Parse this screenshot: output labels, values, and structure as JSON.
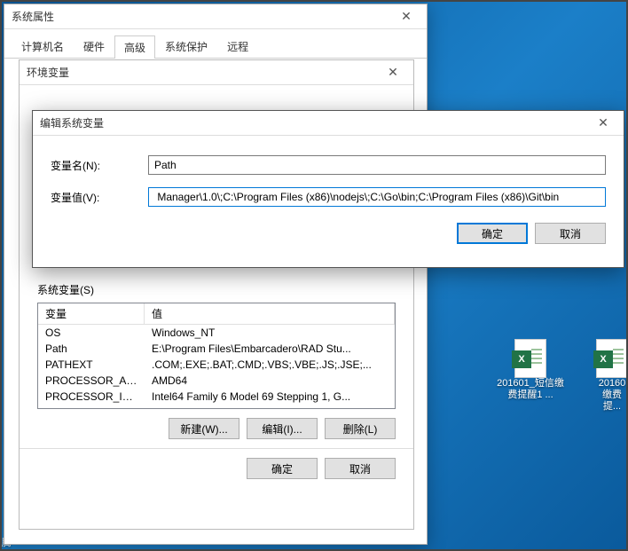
{
  "sysprops": {
    "title": "系统属性",
    "tabs": [
      "计算机名",
      "硬件",
      "高级",
      "系统保护",
      "远程"
    ],
    "active_tab_index": 2
  },
  "envdlg": {
    "title": "环境变量",
    "sys_section": "系统变量(S)",
    "columns": [
      "变量",
      "值"
    ],
    "rows": [
      {
        "name": "OS",
        "value": "Windows_NT"
      },
      {
        "name": "Path",
        "value": "E:\\Program Files\\Embarcadero\\RAD Stu..."
      },
      {
        "name": "PATHEXT",
        "value": ".COM;.EXE;.BAT;.CMD;.VBS;.VBE;.JS;.JSE;..."
      },
      {
        "name": "PROCESSOR_AR...",
        "value": "AMD64"
      },
      {
        "name": "PROCESSOR_IDE...",
        "value": "Intel64 Family 6 Model 69 Stepping 1, G..."
      }
    ],
    "buttons": {
      "new": "新建(W)...",
      "edit": "编辑(I)...",
      "delete": "删除(L)",
      "ok": "确定",
      "cancel": "取消"
    }
  },
  "editdlg": {
    "title": "编辑系统变量",
    "name_label": "变量名(N):",
    "value_label": "变量值(V):",
    "name_value": "Path",
    "value_value": " Manager\\1.0\\;C:\\Program Files (x86)\\nodejs\\;C:\\Go\\bin;C:\\Program Files (x86)\\Git\\bin",
    "ok": "确定",
    "cancel": "取消"
  },
  "desktop": {
    "icons": [
      {
        "label": "201601_短信缴费提醒1 ..."
      },
      {
        "label": "20160 缴费提..."
      }
    ],
    "corner": "腾"
  }
}
